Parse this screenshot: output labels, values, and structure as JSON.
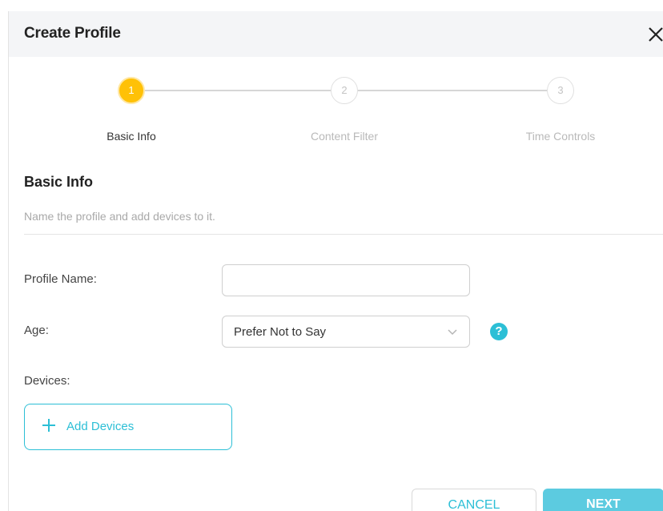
{
  "dialog": {
    "title": "Create Profile",
    "close_icon": "close-icon"
  },
  "stepper": {
    "steps": [
      {
        "number": "1",
        "label": "Basic Info",
        "state": "active"
      },
      {
        "number": "2",
        "label": "Content Filter",
        "state": "inactive"
      },
      {
        "number": "3",
        "label": "Time Controls",
        "state": "inactive"
      }
    ]
  },
  "section": {
    "title": "Basic Info",
    "description": "Name the profile and add devices to it."
  },
  "form": {
    "profile_name_label": "Profile Name:",
    "profile_name_value": "",
    "age_label": "Age:",
    "age_value": "Prefer Not to Say",
    "help_icon": "?",
    "devices_label": "Devices:",
    "add_devices_label": "Add Devices"
  },
  "footer": {
    "cancel_label": "CANCEL",
    "next_label": "NEXT"
  },
  "colors": {
    "accent": "#2cbfd6",
    "step_active": "#ffc107",
    "next_button": "#5ccbe0",
    "header_bg": "#f4f5f7"
  }
}
